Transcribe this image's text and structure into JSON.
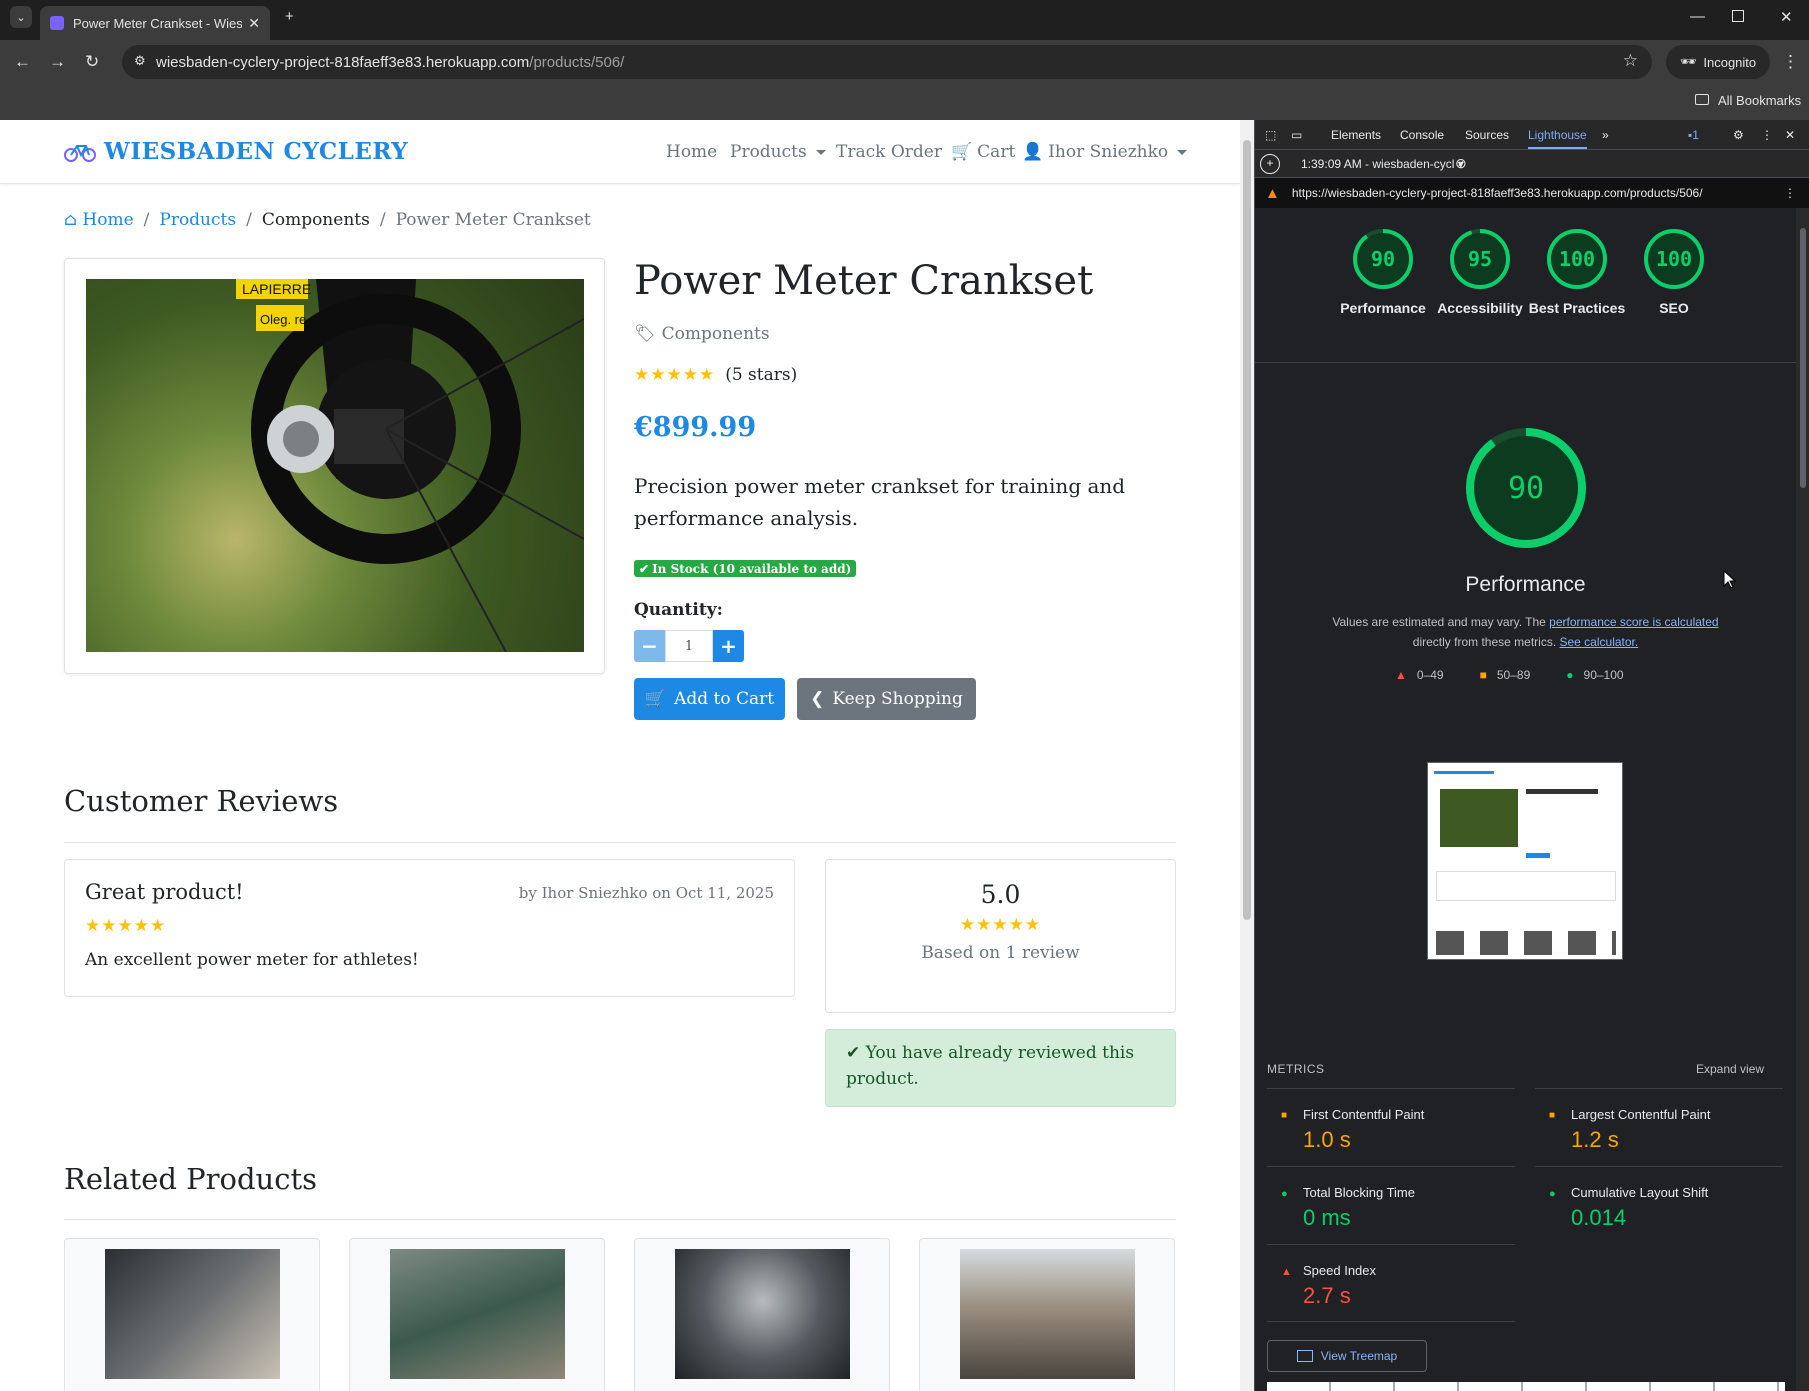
{
  "browser": {
    "tab_title": "Power Meter Crankset - Wiesba",
    "url_host": "wiesbaden-cyclery-project-818faeff3e83.herokuapp.com",
    "url_path": "/products/506/",
    "incognito_label": "Incognito",
    "bookmarks_label": "All Bookmarks"
  },
  "site": {
    "brand": "WIESBADEN CYCLERY",
    "nav": {
      "home": "Home",
      "products": "Products",
      "track": "Track Order",
      "cart": "Cart",
      "user": "Ihor Sniezhko"
    },
    "breadcrumb": {
      "home": "Home",
      "products": "Products",
      "category": "Components",
      "current": "Power Meter Crankset"
    },
    "product": {
      "title": "Power Meter Crankset",
      "category": "Components",
      "stars": "★★★★★",
      "stars_text": "(5 stars)",
      "rating_value": 5,
      "price": "€899.99",
      "description": "Precision power meter crankset for training and performance analysis.",
      "stock": "In Stock (10 available to add)",
      "quantity_label": "Quantity:",
      "quantity": "1",
      "add_to_cart": "Add to Cart",
      "keep_shopping": "Keep Shopping",
      "photo_label_top": "LAPIERRE",
      "photo_label_bottom": "Oleg. re"
    },
    "reviews": {
      "heading": "Customer Reviews",
      "items": [
        {
          "title": "Great product!",
          "meta": "by Ihor Sniezhko on Oct 11, 2025",
          "stars": "★★★★★",
          "body": "An excellent power meter for athletes!"
        }
      ],
      "summary": {
        "score": "5.0",
        "stars": "★★★★★",
        "based_on": "Based on 1 review"
      },
      "already_reviewed": "You have already reviewed this product."
    },
    "related": {
      "heading": "Related Products"
    }
  },
  "devtools": {
    "tabs": [
      "Elements",
      "Console",
      "Sources",
      "Lighthouse"
    ],
    "active_tab": "Lighthouse",
    "issues_count": "1",
    "report_label": "1:39:09 AM - wiesbaden-cycl",
    "report_url": "https://wiesbaden-cyclery-project-818faeff3e83.herokuapp.com/products/506/",
    "scores": [
      {
        "label": "Performance",
        "value": 90
      },
      {
        "label": "Accessibility",
        "value": 95
      },
      {
        "label": "Best Practices",
        "value": 100
      },
      {
        "label": "SEO",
        "value": 100
      }
    ],
    "main_score": {
      "value": "90",
      "label": "Performance"
    },
    "note_prefix": "Values are estimated and may vary. The ",
    "note_link1": "performance score is calculated",
    "note_middle": "directly from these metrics.",
    "note_link2": "See calculator.",
    "legend": {
      "fail": "0–49",
      "average": "50–89",
      "pass": "90–100"
    },
    "metrics_heading": "METRICS",
    "expand_view": "Expand view",
    "metrics": [
      {
        "name": "First Contentful Paint",
        "value": "1.0 s",
        "rating": "average"
      },
      {
        "name": "Largest Contentful Paint",
        "value": "1.2 s",
        "rating": "average"
      },
      {
        "name": "Total Blocking Time",
        "value": "0 ms",
        "rating": "pass"
      },
      {
        "name": "Cumulative Layout Shift",
        "value": "0.014",
        "rating": "pass"
      },
      {
        "name": "Speed Index",
        "value": "2.7 s",
        "rating": "fail"
      }
    ],
    "treemap_button": "View Treemap",
    "colors": {
      "pass": "#0cce6b",
      "average": "#ffa400",
      "fail": "#ff4e42"
    }
  }
}
